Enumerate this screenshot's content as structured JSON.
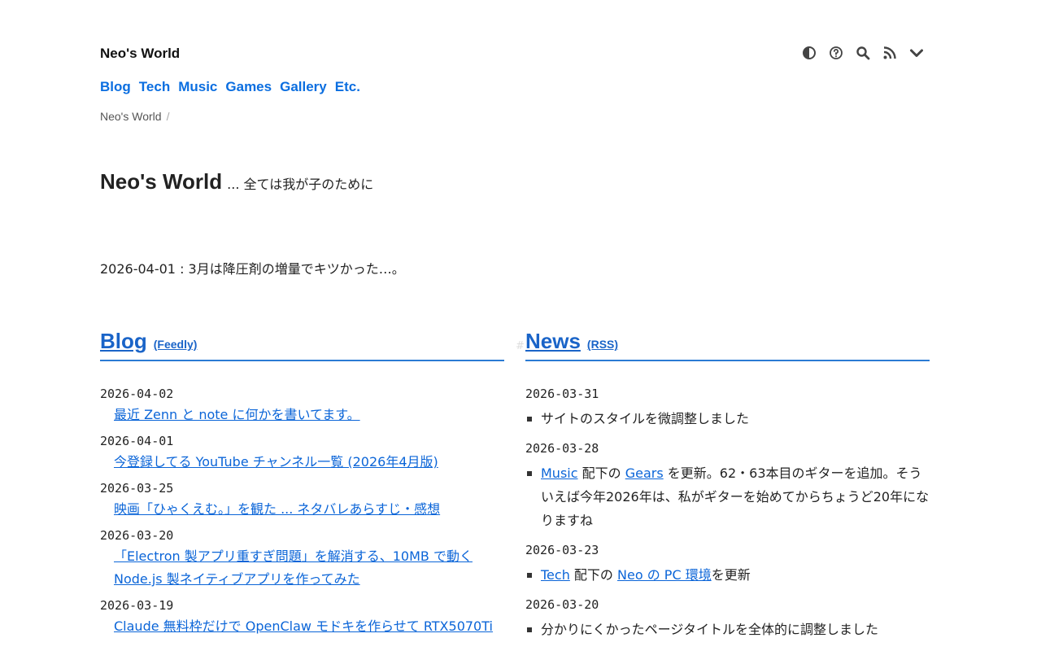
{
  "site": {
    "title": "Neo's World"
  },
  "toolbar": {
    "icons": [
      "contrast-icon",
      "help-icon",
      "search-icon",
      "rss-icon",
      "chevron-down-icon"
    ]
  },
  "nav": {
    "items": [
      "Blog",
      "Tech",
      "Music",
      "Games",
      "Gallery",
      "Etc."
    ]
  },
  "breadcrumb": {
    "home": "Neo's World",
    "separator": "/"
  },
  "hero": {
    "title": "Neo's World",
    "subtitle": "... 全ては我が子のために"
  },
  "notice": {
    "text": "2026-04-01 : 3月は降圧剤の増量でキツかった…。"
  },
  "blog": {
    "heading": "Blog",
    "feed_label": "(Feedly)",
    "entries": [
      {
        "date": "2026-04-02",
        "title": "最近 Zenn と note に何かを書いてます。"
      },
      {
        "date": "2026-04-01",
        "title": "今登録してる YouTube チャンネル一覧 (2026年4月版)"
      },
      {
        "date": "2026-03-25",
        "title": "映画「ひゃくえむ。」を観た ... ネタバレあらすじ・感想"
      },
      {
        "date": "2026-03-20",
        "title": "「Electron 製アプリ重すぎ問題」を解消する、10MB で動く Node.js 製ネイティブアプリを作ってみた"
      },
      {
        "date": "2026-03-19",
        "title": "Claude 無料枠だけで OpenClaw モドキを作らせて RTX5070Ti"
      }
    ]
  },
  "news": {
    "heading": "News",
    "feed_label": "(RSS)",
    "entries": [
      {
        "date": "2026-03-31",
        "text": "サイトのスタイルを微調整しました"
      },
      {
        "date": "2026-03-28",
        "link1": "Music",
        "mid1": " 配下の ",
        "link2": "Gears",
        "rest": " を更新。62・63本目のギターを追加。そういえば今年2026年は、私がギターを始めてからちょうど20年になりますね"
      },
      {
        "date": "2026-03-23",
        "link1": "Tech",
        "mid1": " 配下の ",
        "link2": "Neo の PC 環境",
        "rest": "を更新"
      },
      {
        "date": "2026-03-20",
        "text": "分かりにくかったページタイトルを全体的に調整しました"
      }
    ]
  }
}
